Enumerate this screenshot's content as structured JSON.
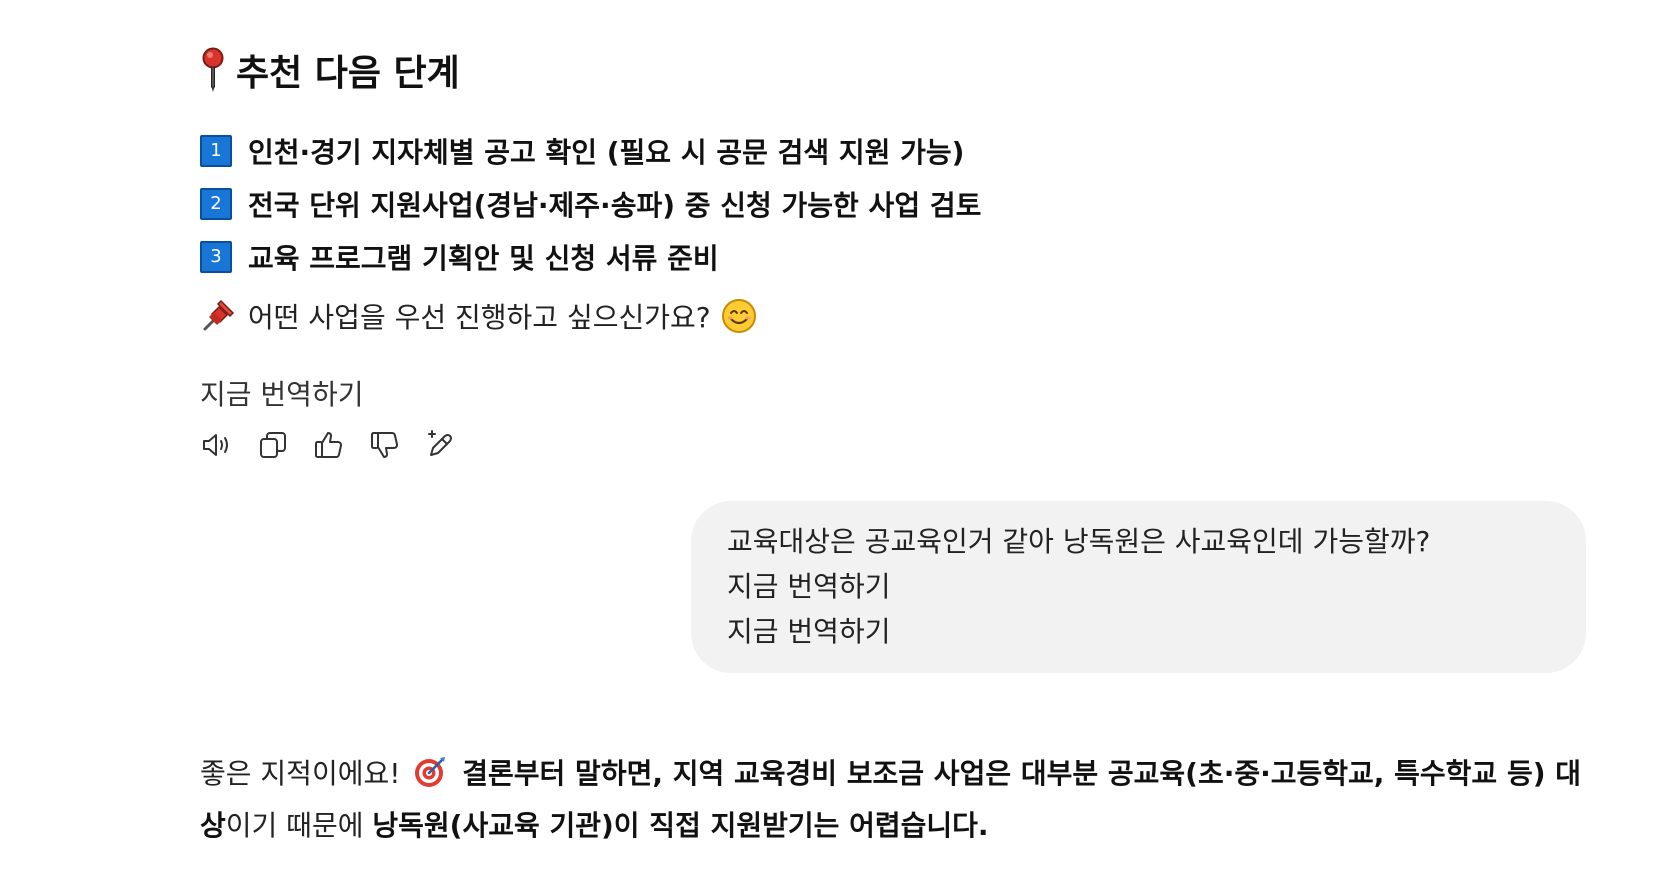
{
  "section": {
    "title": "추천 다음 단계",
    "icon": "round-pushpin-icon"
  },
  "steps": [
    {
      "number": "1",
      "text": "인천·경기 지자체별 공고 확인 (필요 시 공문 검색 지원 가능)"
    },
    {
      "number": "2",
      "text": "전국 단위 지원사업(경남·제주·송파) 중 신청 가능한 사업 검토"
    },
    {
      "number": "3",
      "text": "교육 프로그램 기획안 및 신청 서류 준비"
    }
  ],
  "question": {
    "icon": "pushpin-icon",
    "text": "어떤 사업을 우선 진행하고 싶으신가요?",
    "emoji": "smiling-face-icon"
  },
  "assistant_translate": "지금 번역하기",
  "actions": [
    {
      "name": "read-aloud",
      "icon": "speaker-icon"
    },
    {
      "name": "copy",
      "icon": "copy-icon"
    },
    {
      "name": "thumbs-up",
      "icon": "thumbs-up-icon"
    },
    {
      "name": "thumbs-down",
      "icon": "thumbs-down-icon"
    },
    {
      "name": "edit",
      "icon": "edit-sparkle-icon"
    }
  ],
  "user_message": {
    "text": "교육대상은 공교육인거 같아 낭독원은 사교육인데 가능할까?",
    "translate_1": "지금 번역하기",
    "translate_2": "지금 번역하기"
  },
  "answer": {
    "part1": "좋은 지적이에요!",
    "emoji": "direct-hit-target-icon",
    "part2_bold": "결론부터 말하면, 지역 교육경비 보조금 사업은 대부분 공교육(초·중·고등학교, 특수학교 등) 대상",
    "part3": "이기 때문에",
    "part4_bold": "낭독원(사교육 기관)이 직접 지원받기는 어렵습니다."
  },
  "colors": {
    "keycap_blue": "#1877d6",
    "bubble_bg": "#f2f2f2",
    "pin_red": "#d9342b"
  }
}
